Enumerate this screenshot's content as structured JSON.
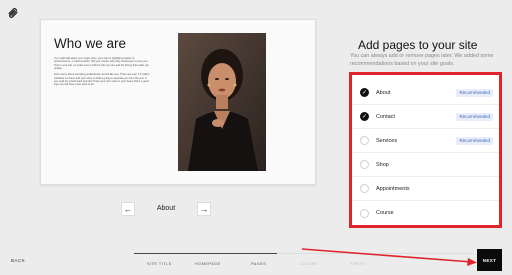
{
  "colors": {
    "accent": "#111111",
    "highlight": "#e0242c",
    "badge_text": "#3b64b8",
    "badge_bg": "#e8eef9"
  },
  "preview": {
    "title": "Who we are",
    "body": [
      "You might talk about your origin story, your team's highlight projects or achievements, or share photos. Tell your visitors why they should get to know you. This is your site, so make sure it reflects who you are and the things that make you unique.",
      "Don't worry about sounding professional. Sound like you. There are over 1.5 million websites out there and your story is what's going to separate you from the rest. If you read the words back and don't hear your own voice in your head, that's a good sign you still have more work to do."
    ],
    "photo_icon": "portrait-photo",
    "current_page": "About",
    "prev_icon": "arrow-left-icon",
    "next_icon": "arrow-right-icon"
  },
  "panel": {
    "title": "Add pages to your site",
    "subtitle": "You can always add or remove pages later. We added some recommendations based on your site goals.",
    "pages": [
      {
        "label": "About",
        "checked": true,
        "badge": "Recommended"
      },
      {
        "label": "Contact",
        "checked": true,
        "badge": "Recommended"
      },
      {
        "label": "Services",
        "checked": false,
        "badge": "Recommended"
      },
      {
        "label": "Shop",
        "checked": false,
        "badge": ""
      },
      {
        "label": "Appointments",
        "checked": false,
        "badge": ""
      },
      {
        "label": "Course",
        "checked": false,
        "badge": ""
      }
    ]
  },
  "footer": {
    "back": "BACK",
    "steps": [
      {
        "label": "SITE TITLE",
        "done": true
      },
      {
        "label": "HOMEPAGE",
        "done": true
      },
      {
        "label": "PAGES",
        "done": true
      },
      {
        "label": "COLORS",
        "done": false
      },
      {
        "label": "FONTS",
        "done": false
      }
    ],
    "next": "NEXT",
    "progress": 0.42
  }
}
